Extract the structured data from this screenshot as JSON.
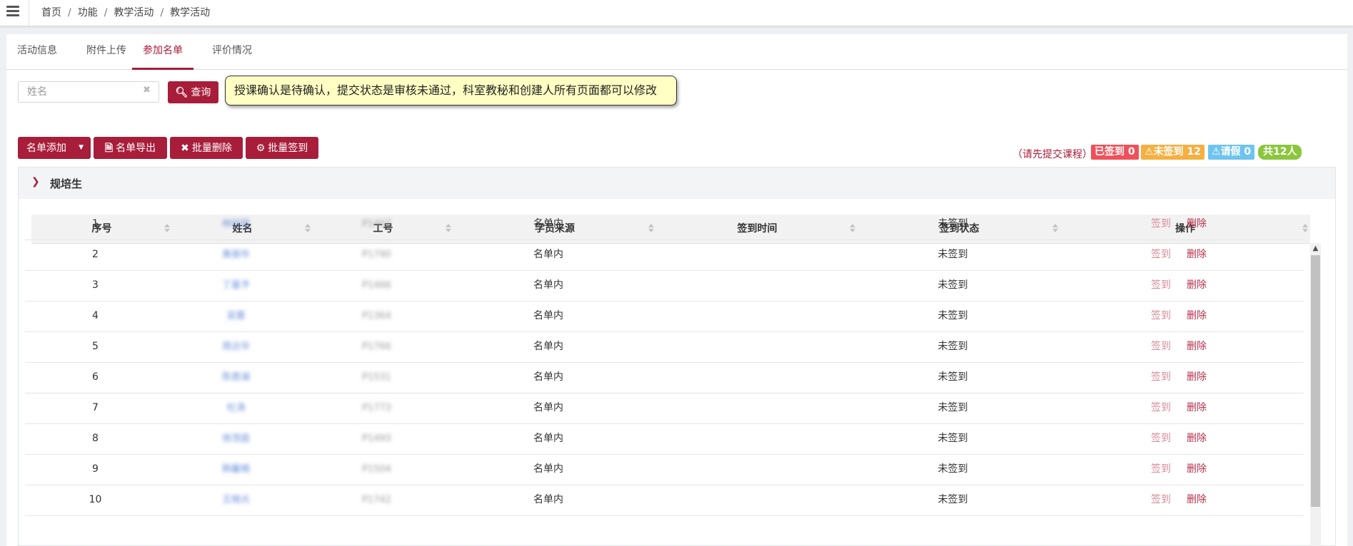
{
  "breadcrumb": [
    "首页",
    "功能",
    "教学活动",
    "教学活动"
  ],
  "tabs": [
    {
      "label": "活动信息",
      "active": false
    },
    {
      "label": "附件上传",
      "active": false
    },
    {
      "label": "参加名单",
      "active": true
    },
    {
      "label": "评价情况",
      "active": false
    }
  ],
  "search": {
    "placeholder": "姓名",
    "value": ""
  },
  "buttons": {
    "query": "查询",
    "add_list": "名单添加",
    "export_list": "名单导出",
    "batch_delete": "批量删除",
    "batch_checkin": "批量签到"
  },
  "tooltip": "授课确认是待确认，提交状态是审核未通过，科室教秘和创建人所有页面都可以修改",
  "status_note": "（请先提交课程）",
  "badges": {
    "checked_in": "已签到 0",
    "not_checked_in": "未签到 12",
    "leave": "请假 0",
    "total": "共12人"
  },
  "colors": {
    "primary": "#a81d3a",
    "checked_in": "#f0505a",
    "not_checked_in": "#f5b041",
    "leave": "#6ec4ee",
    "total": "#8cc63e"
  },
  "section_title": "规培生",
  "table": {
    "columns": [
      "序号",
      "姓名",
      "工号",
      "学员来源",
      "签到时间",
      "签到状态",
      "操作"
    ],
    "rows": [
      {
        "no": "1",
        "name": "林欣瑶",
        "emp_id": "P1407",
        "source": "名单内",
        "checkin_time": "",
        "status": "未签到"
      },
      {
        "no": "2",
        "name": "黄振华",
        "emp_id": "P1790",
        "source": "名单内",
        "checkin_time": "",
        "status": "未签到"
      },
      {
        "no": "3",
        "name": "丁嘉予",
        "emp_id": "P1466",
        "source": "名单内",
        "checkin_time": "",
        "status": "未签到"
      },
      {
        "no": "4",
        "name": "吴蕾",
        "emp_id": "P1364",
        "source": "名单内",
        "checkin_time": "",
        "status": "未签到"
      },
      {
        "no": "5",
        "name": "周达华",
        "emp_id": "P1766",
        "source": "名单内",
        "checkin_time": "",
        "status": "未签到"
      },
      {
        "no": "6",
        "name": "陈君澜",
        "emp_id": "P1531",
        "source": "名单内",
        "checkin_time": "",
        "status": "未签到"
      },
      {
        "no": "7",
        "name": "杜涛",
        "emp_id": "P1773",
        "source": "名单内",
        "checkin_time": "",
        "status": "未签到"
      },
      {
        "no": "8",
        "name": "徐茂庭",
        "emp_id": "P1493",
        "source": "名单内",
        "checkin_time": "",
        "status": "未签到"
      },
      {
        "no": "9",
        "name": "韩馨楠",
        "emp_id": "P1504",
        "source": "名单内",
        "checkin_time": "",
        "status": "未签到"
      },
      {
        "no": "10",
        "name": "王晓光",
        "emp_id": "P1742",
        "source": "名单内",
        "checkin_time": "",
        "status": "未签到"
      }
    ],
    "actions": {
      "checkin": "签到",
      "delete": "删除"
    }
  }
}
